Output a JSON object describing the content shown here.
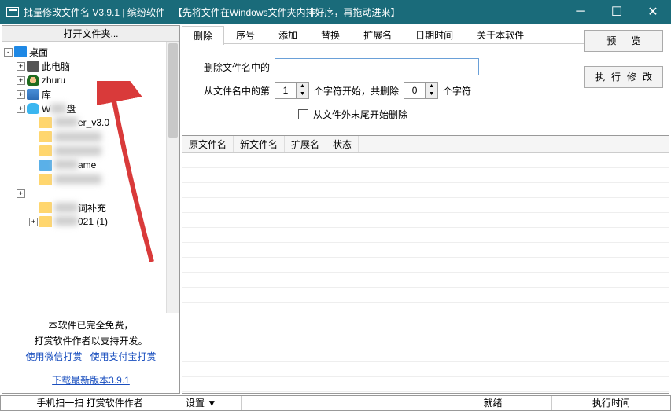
{
  "titlebar": {
    "title": "批量修改文件名 V3.9.1 | 缤纷软件   【先将文件在Windows文件夹内排好序，再拖动进来】"
  },
  "left": {
    "header": "打开文件夹...",
    "tree": [
      {
        "exp": "-",
        "icon": "desktop",
        "label": "桌面",
        "indent": 0
      },
      {
        "exp": "+",
        "icon": "pc",
        "label": "此电脑",
        "indent": 1
      },
      {
        "exp": "+",
        "icon": "user",
        "label": "zhuru",
        "indent": 1
      },
      {
        "exp": "+",
        "icon": "lib",
        "label": "库",
        "indent": 1
      },
      {
        "exp": "+",
        "icon": "cloud",
        "label": "W    盘",
        "indent": 1,
        "blurTail": true
      },
      {
        "exp": "",
        "icon": "folder",
        "label": "           er_v3.0",
        "indent": 2,
        "blurHead": true
      },
      {
        "exp": "",
        "icon": "folder",
        "label": "              ",
        "indent": 2,
        "blurAll": true
      },
      {
        "exp": "",
        "icon": "folder",
        "label": "           ",
        "indent": 2,
        "blurAll": true
      },
      {
        "exp": "",
        "icon": "blue",
        "label": "    ame",
        "indent": 2,
        "blurHead": true
      },
      {
        "exp": "",
        "icon": "folder",
        "label": "        ",
        "indent": 2,
        "blurAll": true
      },
      {
        "exp": "+",
        "icon": "",
        "label": "",
        "indent": 1
      },
      {
        "exp": "",
        "icon": "folder",
        "label": "   词补充",
        "indent": 2,
        "blurHead": true
      },
      {
        "exp": "+",
        "icon": "folder",
        "label": "      021 (1)",
        "indent": 2,
        "blurHead": true
      }
    ],
    "promo1": "本软件已完全免费，",
    "promo2": "打赏软件作者以支持开发。",
    "link_wx": "使用微信打赏",
    "link_zfb": "使用支付宝打赏",
    "link_dl": "下载最新版本3.9.1"
  },
  "tabs": [
    "删除",
    "序号",
    "添加",
    "替换",
    "扩展名",
    "日期时间",
    "关于本软件"
  ],
  "active_tab": 0,
  "buttons": {
    "preview": "预    览",
    "apply": "执行修改"
  },
  "form": {
    "del_label": "删除文件名中的",
    "del_value": "",
    "from_a": "从文件名中的第",
    "spin1": "1",
    "from_b": "个字符开始，共删除",
    "spin2": "0",
    "from_c": "个字符",
    "cb_label": "从文件外末尾开始删除"
  },
  "table": {
    "cols": [
      "原文件名",
      "新文件名",
      "扩展名",
      "状态"
    ]
  },
  "status": {
    "left": "手机扫一扫 打赏软件作者",
    "settings": "设置 ▼",
    "ready": "就绪",
    "time": "执行时间"
  }
}
